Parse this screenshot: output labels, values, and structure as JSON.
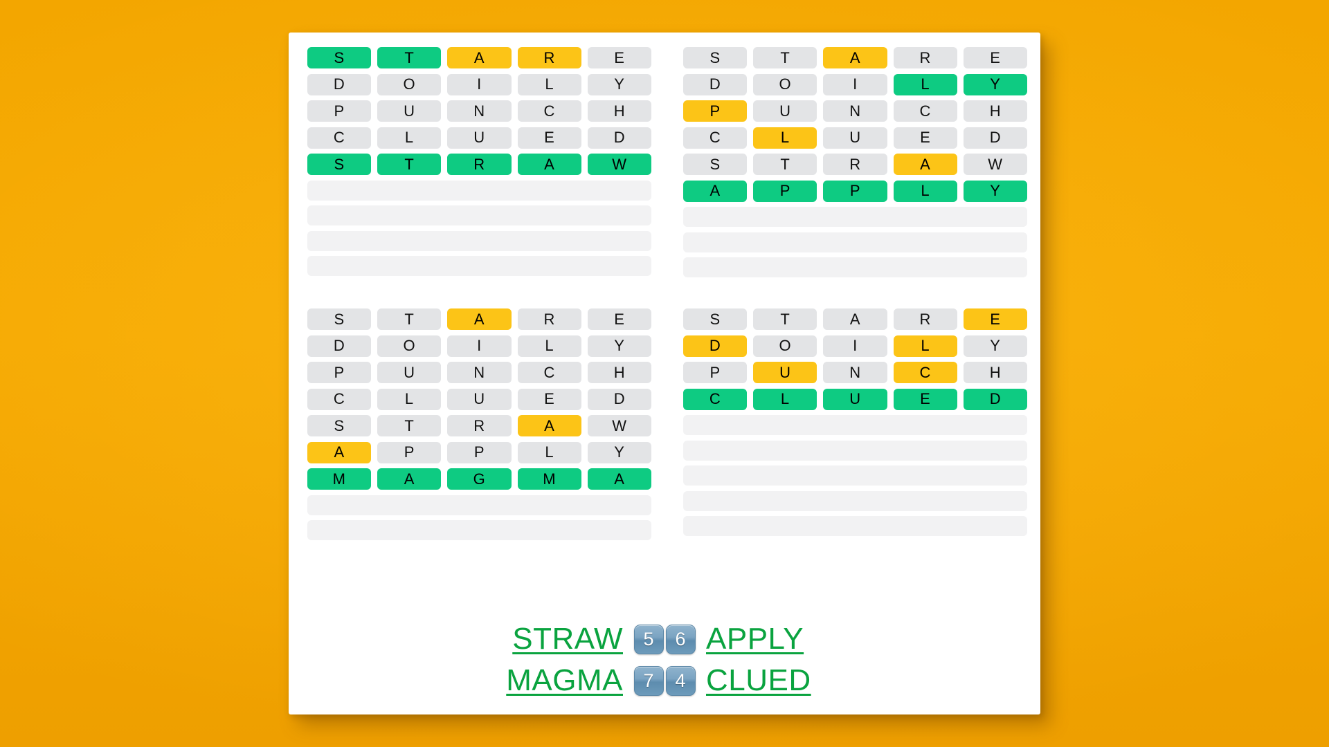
{
  "theme": {
    "background": "#F5A800",
    "card_background": "#FFFFFF",
    "tile_absent": "#E3E4E6",
    "tile_present": "#FCC417",
    "tile_correct": "#0ECB82",
    "answer_word_color": "#0AA33F",
    "badge_color": "#7BA4C2"
  },
  "boards": [
    {
      "name": "board-top-left",
      "answer": "STRAW",
      "rows": [
        {
          "letters": [
            "S",
            "T",
            "A",
            "R",
            "E"
          ],
          "states": [
            "correct",
            "correct",
            "present",
            "present",
            "absent"
          ]
        },
        {
          "letters": [
            "D",
            "O",
            "I",
            "L",
            "Y"
          ],
          "states": [
            "absent",
            "absent",
            "absent",
            "absent",
            "absent"
          ]
        },
        {
          "letters": [
            "P",
            "U",
            "N",
            "C",
            "H"
          ],
          "states": [
            "absent",
            "absent",
            "absent",
            "absent",
            "absent"
          ]
        },
        {
          "letters": [
            "C",
            "L",
            "U",
            "E",
            "D"
          ],
          "states": [
            "absent",
            "absent",
            "absent",
            "absent",
            "absent"
          ]
        },
        {
          "letters": [
            "S",
            "T",
            "R",
            "A",
            "W"
          ],
          "states": [
            "correct",
            "correct",
            "correct",
            "correct",
            "correct"
          ]
        },
        {
          "letters": [
            "",
            "",
            "",
            "",
            ""
          ],
          "states": [
            "blank",
            "blank",
            "blank",
            "blank",
            "blank"
          ]
        },
        {
          "letters": [
            "",
            "",
            "",
            "",
            ""
          ],
          "states": [
            "blank",
            "blank",
            "blank",
            "blank",
            "blank"
          ]
        },
        {
          "letters": [
            "",
            "",
            "",
            "",
            ""
          ],
          "states": [
            "blank",
            "blank",
            "blank",
            "blank",
            "blank"
          ]
        },
        {
          "letters": [
            "",
            "",
            "",
            "",
            ""
          ],
          "states": [
            "blank",
            "blank",
            "blank",
            "blank",
            "blank"
          ]
        }
      ]
    },
    {
      "name": "board-top-right",
      "answer": "APPLY",
      "rows": [
        {
          "letters": [
            "S",
            "T",
            "A",
            "R",
            "E"
          ],
          "states": [
            "absent",
            "absent",
            "present",
            "absent",
            "absent"
          ]
        },
        {
          "letters": [
            "D",
            "O",
            "I",
            "L",
            "Y"
          ],
          "states": [
            "absent",
            "absent",
            "absent",
            "correct",
            "correct"
          ]
        },
        {
          "letters": [
            "P",
            "U",
            "N",
            "C",
            "H"
          ],
          "states": [
            "present",
            "absent",
            "absent",
            "absent",
            "absent"
          ]
        },
        {
          "letters": [
            "C",
            "L",
            "U",
            "E",
            "D"
          ],
          "states": [
            "absent",
            "present",
            "absent",
            "absent",
            "absent"
          ]
        },
        {
          "letters": [
            "S",
            "T",
            "R",
            "A",
            "W"
          ],
          "states": [
            "absent",
            "absent",
            "absent",
            "present",
            "absent"
          ]
        },
        {
          "letters": [
            "A",
            "P",
            "P",
            "L",
            "Y"
          ],
          "states": [
            "correct",
            "correct",
            "correct",
            "correct",
            "correct"
          ]
        },
        {
          "letters": [
            "",
            "",
            "",
            "",
            ""
          ],
          "states": [
            "blank",
            "blank",
            "blank",
            "blank",
            "blank"
          ]
        },
        {
          "letters": [
            "",
            "",
            "",
            "",
            ""
          ],
          "states": [
            "blank",
            "blank",
            "blank",
            "blank",
            "blank"
          ]
        },
        {
          "letters": [
            "",
            "",
            "",
            "",
            ""
          ],
          "states": [
            "blank",
            "blank",
            "blank",
            "blank",
            "blank"
          ]
        }
      ]
    },
    {
      "name": "board-bottom-left",
      "answer": "MAGMA",
      "rows": [
        {
          "letters": [
            "S",
            "T",
            "A",
            "R",
            "E"
          ],
          "states": [
            "absent",
            "absent",
            "present",
            "absent",
            "absent"
          ]
        },
        {
          "letters": [
            "D",
            "O",
            "I",
            "L",
            "Y"
          ],
          "states": [
            "absent",
            "absent",
            "absent",
            "absent",
            "absent"
          ]
        },
        {
          "letters": [
            "P",
            "U",
            "N",
            "C",
            "H"
          ],
          "states": [
            "absent",
            "absent",
            "absent",
            "absent",
            "absent"
          ]
        },
        {
          "letters": [
            "C",
            "L",
            "U",
            "E",
            "D"
          ],
          "states": [
            "absent",
            "absent",
            "absent",
            "absent",
            "absent"
          ]
        },
        {
          "letters": [
            "S",
            "T",
            "R",
            "A",
            "W"
          ],
          "states": [
            "absent",
            "absent",
            "absent",
            "present",
            "absent"
          ]
        },
        {
          "letters": [
            "A",
            "P",
            "P",
            "L",
            "Y"
          ],
          "states": [
            "present",
            "absent",
            "absent",
            "absent",
            "absent"
          ]
        },
        {
          "letters": [
            "M",
            "A",
            "G",
            "M",
            "A"
          ],
          "states": [
            "correct",
            "correct",
            "correct",
            "correct",
            "correct"
          ]
        },
        {
          "letters": [
            "",
            "",
            "",
            "",
            ""
          ],
          "states": [
            "blank",
            "blank",
            "blank",
            "blank",
            "blank"
          ]
        },
        {
          "letters": [
            "",
            "",
            "",
            "",
            ""
          ],
          "states": [
            "blank",
            "blank",
            "blank",
            "blank",
            "blank"
          ]
        }
      ]
    },
    {
      "name": "board-bottom-right",
      "answer": "CLUED",
      "rows": [
        {
          "letters": [
            "S",
            "T",
            "A",
            "R",
            "E"
          ],
          "states": [
            "absent",
            "absent",
            "absent",
            "absent",
            "present"
          ]
        },
        {
          "letters": [
            "D",
            "O",
            "I",
            "L",
            "Y"
          ],
          "states": [
            "present",
            "absent",
            "absent",
            "present",
            "absent"
          ]
        },
        {
          "letters": [
            "P",
            "U",
            "N",
            "C",
            "H"
          ],
          "states": [
            "absent",
            "present",
            "absent",
            "present",
            "absent"
          ]
        },
        {
          "letters": [
            "C",
            "L",
            "U",
            "E",
            "D"
          ],
          "states": [
            "correct",
            "correct",
            "correct",
            "correct",
            "correct"
          ]
        },
        {
          "letters": [
            "",
            "",
            "",
            "",
            ""
          ],
          "states": [
            "blank",
            "blank",
            "blank",
            "blank",
            "blank"
          ]
        },
        {
          "letters": [
            "",
            "",
            "",
            "",
            ""
          ],
          "states": [
            "blank",
            "blank",
            "blank",
            "blank",
            "blank"
          ]
        },
        {
          "letters": [
            "",
            "",
            "",
            "",
            ""
          ],
          "states": [
            "blank",
            "blank",
            "blank",
            "blank",
            "blank"
          ]
        },
        {
          "letters": [
            "",
            "",
            "",
            "",
            ""
          ],
          "states": [
            "blank",
            "blank",
            "blank",
            "blank",
            "blank"
          ]
        },
        {
          "letters": [
            "",
            "",
            "",
            "",
            ""
          ],
          "states": [
            "blank",
            "blank",
            "blank",
            "blank",
            "blank"
          ]
        }
      ]
    }
  ],
  "answers_footer": {
    "rows": [
      {
        "left_word": "STRAW",
        "left_badge": "5",
        "right_badge": "6",
        "right_word": "APPLY"
      },
      {
        "left_word": "MAGMA",
        "left_badge": "7",
        "right_badge": "4",
        "right_word": "CLUED"
      }
    ]
  }
}
